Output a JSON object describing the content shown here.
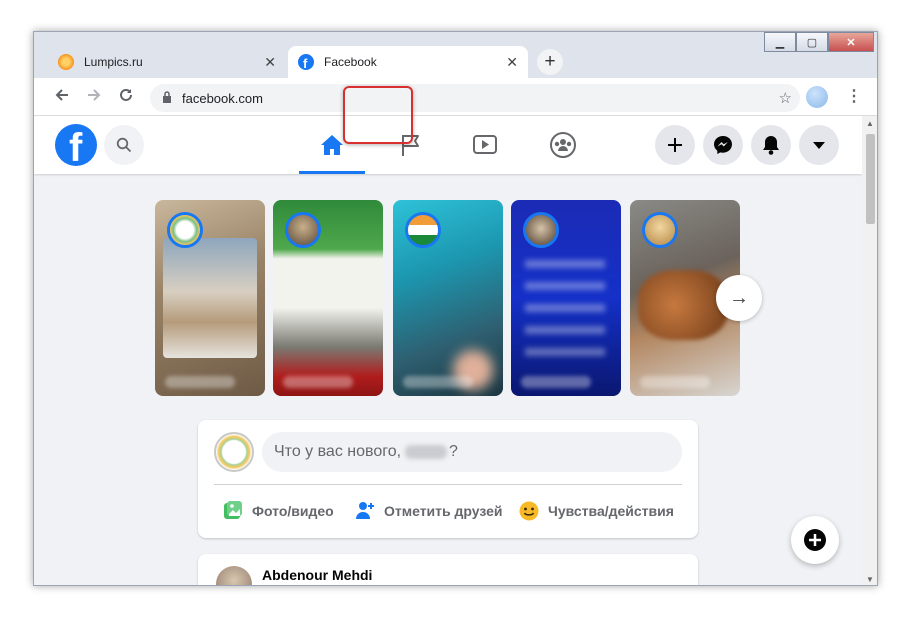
{
  "browser": {
    "tabs": [
      {
        "title": "Lumpics.ru",
        "favicon": "lumpics-favicon",
        "active": false
      },
      {
        "title": "Facebook",
        "favicon": "facebook-favicon",
        "active": true
      }
    ],
    "close_glyph": "✕",
    "new_tab_glyph": "+",
    "address": "facebook.com",
    "window_controls": {
      "minimize": "▁",
      "maximize": "▢",
      "close": "✕"
    }
  },
  "facebook": {
    "logo_letter": "f",
    "nav_tabs": [
      {
        "name": "home",
        "icon": "home-icon",
        "active": true
      },
      {
        "name": "pages",
        "icon": "flag-icon",
        "active": false,
        "highlighted": true
      },
      {
        "name": "watch",
        "icon": "video-play-icon",
        "active": false
      },
      {
        "name": "groups",
        "icon": "groups-icon",
        "active": false
      }
    ],
    "right_buttons": [
      "plus-icon",
      "messenger-icon",
      "notifications-bell-icon",
      "account-dropdown-icon"
    ],
    "stories_next_glyph": "→",
    "composer": {
      "prompt_prefix": "Что у вас нового,",
      "prompt_suffix": "?",
      "actions": [
        {
          "label": "Фото/видео",
          "icon": "photo-video-icon",
          "color": "#45bd62"
        },
        {
          "label": "Отметить друзей",
          "icon": "tag-friends-icon",
          "color": "#1877f2"
        },
        {
          "label": "Чувства/действия",
          "icon": "feeling-icon",
          "color": "#f7b928"
        }
      ]
    },
    "post": {
      "author": "Abdenour Mehdi"
    }
  },
  "colors": {
    "brand": "#1877f2",
    "highlight": "#d8302f",
    "page_bg": "#f0f2f5"
  }
}
